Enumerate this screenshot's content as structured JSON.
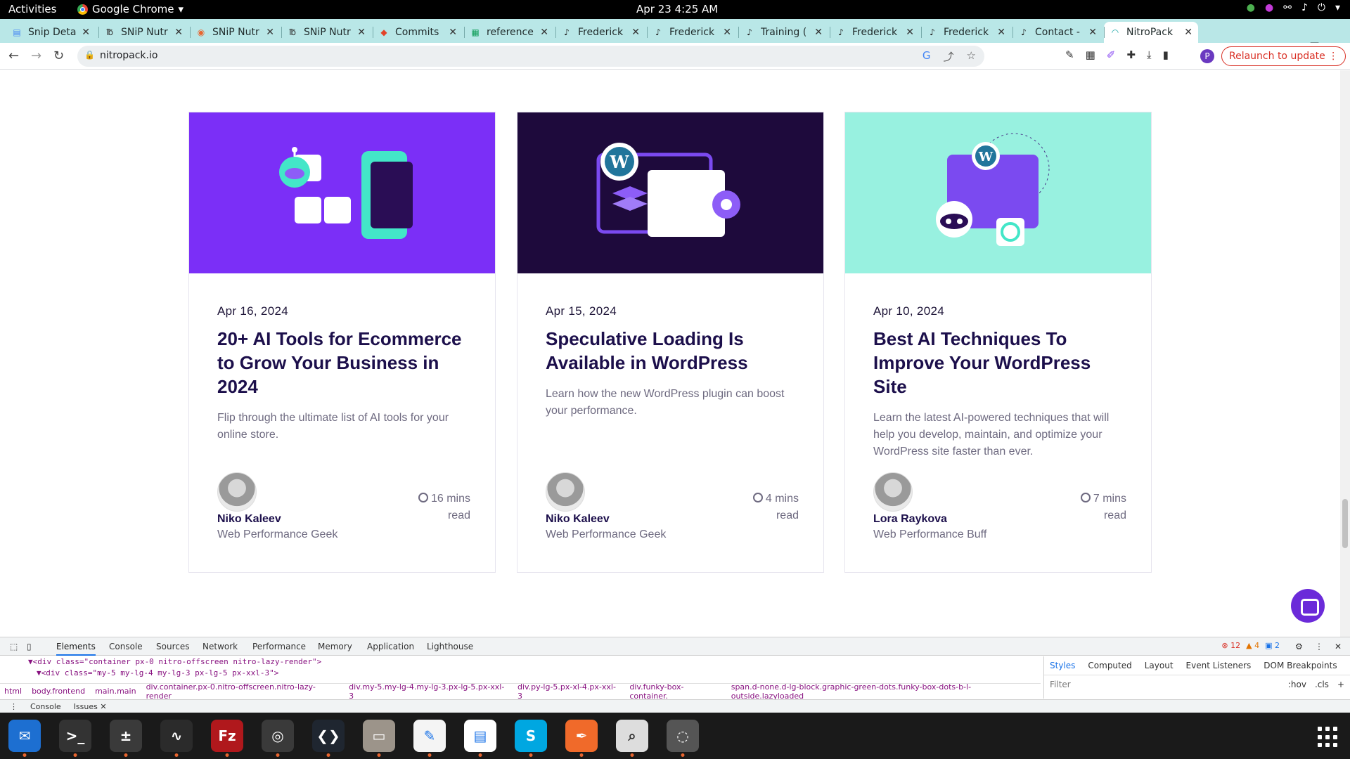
{
  "topbar": {
    "activities": "Activities",
    "app": "Google Chrome",
    "clock": "Apr 23  4:25 AM"
  },
  "tabs": [
    {
      "label": "Snip Deta",
      "icon": "doc-icon"
    },
    {
      "label": "SNiP Nutr",
      "icon": "snip-icon"
    },
    {
      "label": "SNiP Nutr",
      "icon": "snip-color-icon"
    },
    {
      "label": "SNiP Nutr",
      "icon": "snip-icon"
    },
    {
      "label": "Commits",
      "icon": "gitlab-icon"
    },
    {
      "label": "reference",
      "icon": "sheets-icon"
    },
    {
      "label": "Frederick",
      "icon": "note-icon"
    },
    {
      "label": "Frederick",
      "icon": "note-icon"
    },
    {
      "label": "Training (",
      "icon": "note-icon"
    },
    {
      "label": "Frederick",
      "icon": "note-icon"
    },
    {
      "label": "Frederick",
      "icon": "note-icon"
    },
    {
      "label": "Contact -",
      "icon": "note-icon"
    },
    {
      "label": "NitroPack",
      "icon": "nitropack-icon"
    }
  ],
  "address": {
    "url": "nitropack.io"
  },
  "relaunch": "Relaunch to update",
  "profile_initial": "P",
  "cards": [
    {
      "date": "Apr 16, 2024",
      "title": "20+ AI Tools for Ecommerce to Grow Your Business in 2024",
      "desc": "Flip through the ultimate list of AI tools for your online store.",
      "author": "Niko Kaleev",
      "role": "Web Performance Geek",
      "read_num": "16 mins",
      "read_word": "read",
      "banner_color": "#7b2ff7"
    },
    {
      "date": "Apr 15, 2024",
      "title": "Speculative Loading Is Available in WordPress",
      "desc": "Learn how the new WordPress plugin can boost your performance.",
      "author": "Niko Kaleev",
      "role": "Web Performance Geek",
      "read_num": "4 mins",
      "read_word": "read",
      "banner_color": "#1e0a3c"
    },
    {
      "date": "Apr 10, 2024",
      "title": "Best AI Techniques To Improve Your WordPress Site",
      "desc": "Learn the latest AI-powered techniques that will help you develop, maintain, and optimize your WordPress site faster than ever.",
      "author": "Lora Raykova",
      "role": "Web Performance Buff",
      "read_num": "7 mins",
      "read_word": "read",
      "banner_color": "#98f1e0"
    }
  ],
  "devtools": {
    "tabs": [
      "Elements",
      "Console",
      "Sources",
      "Network",
      "Performance",
      "Memory",
      "Application",
      "Lighthouse"
    ],
    "errors": "12",
    "warnings": "4",
    "info": "2",
    "code_line1": "▼<div class=\"container px-0 nitro-offscreen nitro-lazy-render\">",
    "code_line2": "▼<div class=\"my-5 my-lg-4 my-lg-3 px-lg-5 px-xxl-3\">",
    "crumbs": [
      "html",
      "body.frontend",
      "main.main",
      "div.container.px-0.nitro-offscreen.nitro-lazy-render",
      "div.my-5.my-lg-4.my-lg-3.px-lg-5.px-xxl-3",
      "div.py-lg-5.px-xl-4.px-xxl-3",
      "div.funky-box-container.",
      "span.d-none.d-lg-block.graphic-green-dots.funky-box-dots-b-l-outside.lazyloaded"
    ],
    "side_tabs": [
      "Styles",
      "Computed",
      "Layout",
      "Event Listeners",
      "DOM Breakpoints"
    ],
    "filter_placeholder": "Filter",
    "filter_hov": ":hov",
    "filter_cls": ".cls",
    "drawer_tabs": [
      "Console",
      "Issues"
    ]
  },
  "dock": [
    {
      "icon": "thunderbird-icon",
      "color": "#1d6fd1"
    },
    {
      "icon": "terminal-icon",
      "color": "#333333"
    },
    {
      "icon": "calculator-icon",
      "color": "#3a3a3a"
    },
    {
      "icon": "system-monitor-icon",
      "color": "#2b2b2b"
    },
    {
      "icon": "filezilla-icon",
      "color": "#b0181c"
    },
    {
      "icon": "chrome-icon",
      "color": "#3a3a3a"
    },
    {
      "icon": "vscode-icon",
      "color": "#1f2630"
    },
    {
      "icon": "files-icon",
      "color": "#9c948a"
    },
    {
      "icon": "text-editor-icon",
      "color": "#f4f4f4"
    },
    {
      "icon": "writer-icon",
      "color": "#ffffff"
    },
    {
      "icon": "skype-icon",
      "color": "#00a7e1"
    },
    {
      "icon": "inkscape-icon",
      "color": "#f06a2a"
    },
    {
      "icon": "image-viewer-icon",
      "color": "#ddd"
    },
    {
      "icon": "disk-icon",
      "color": "#555"
    }
  ]
}
